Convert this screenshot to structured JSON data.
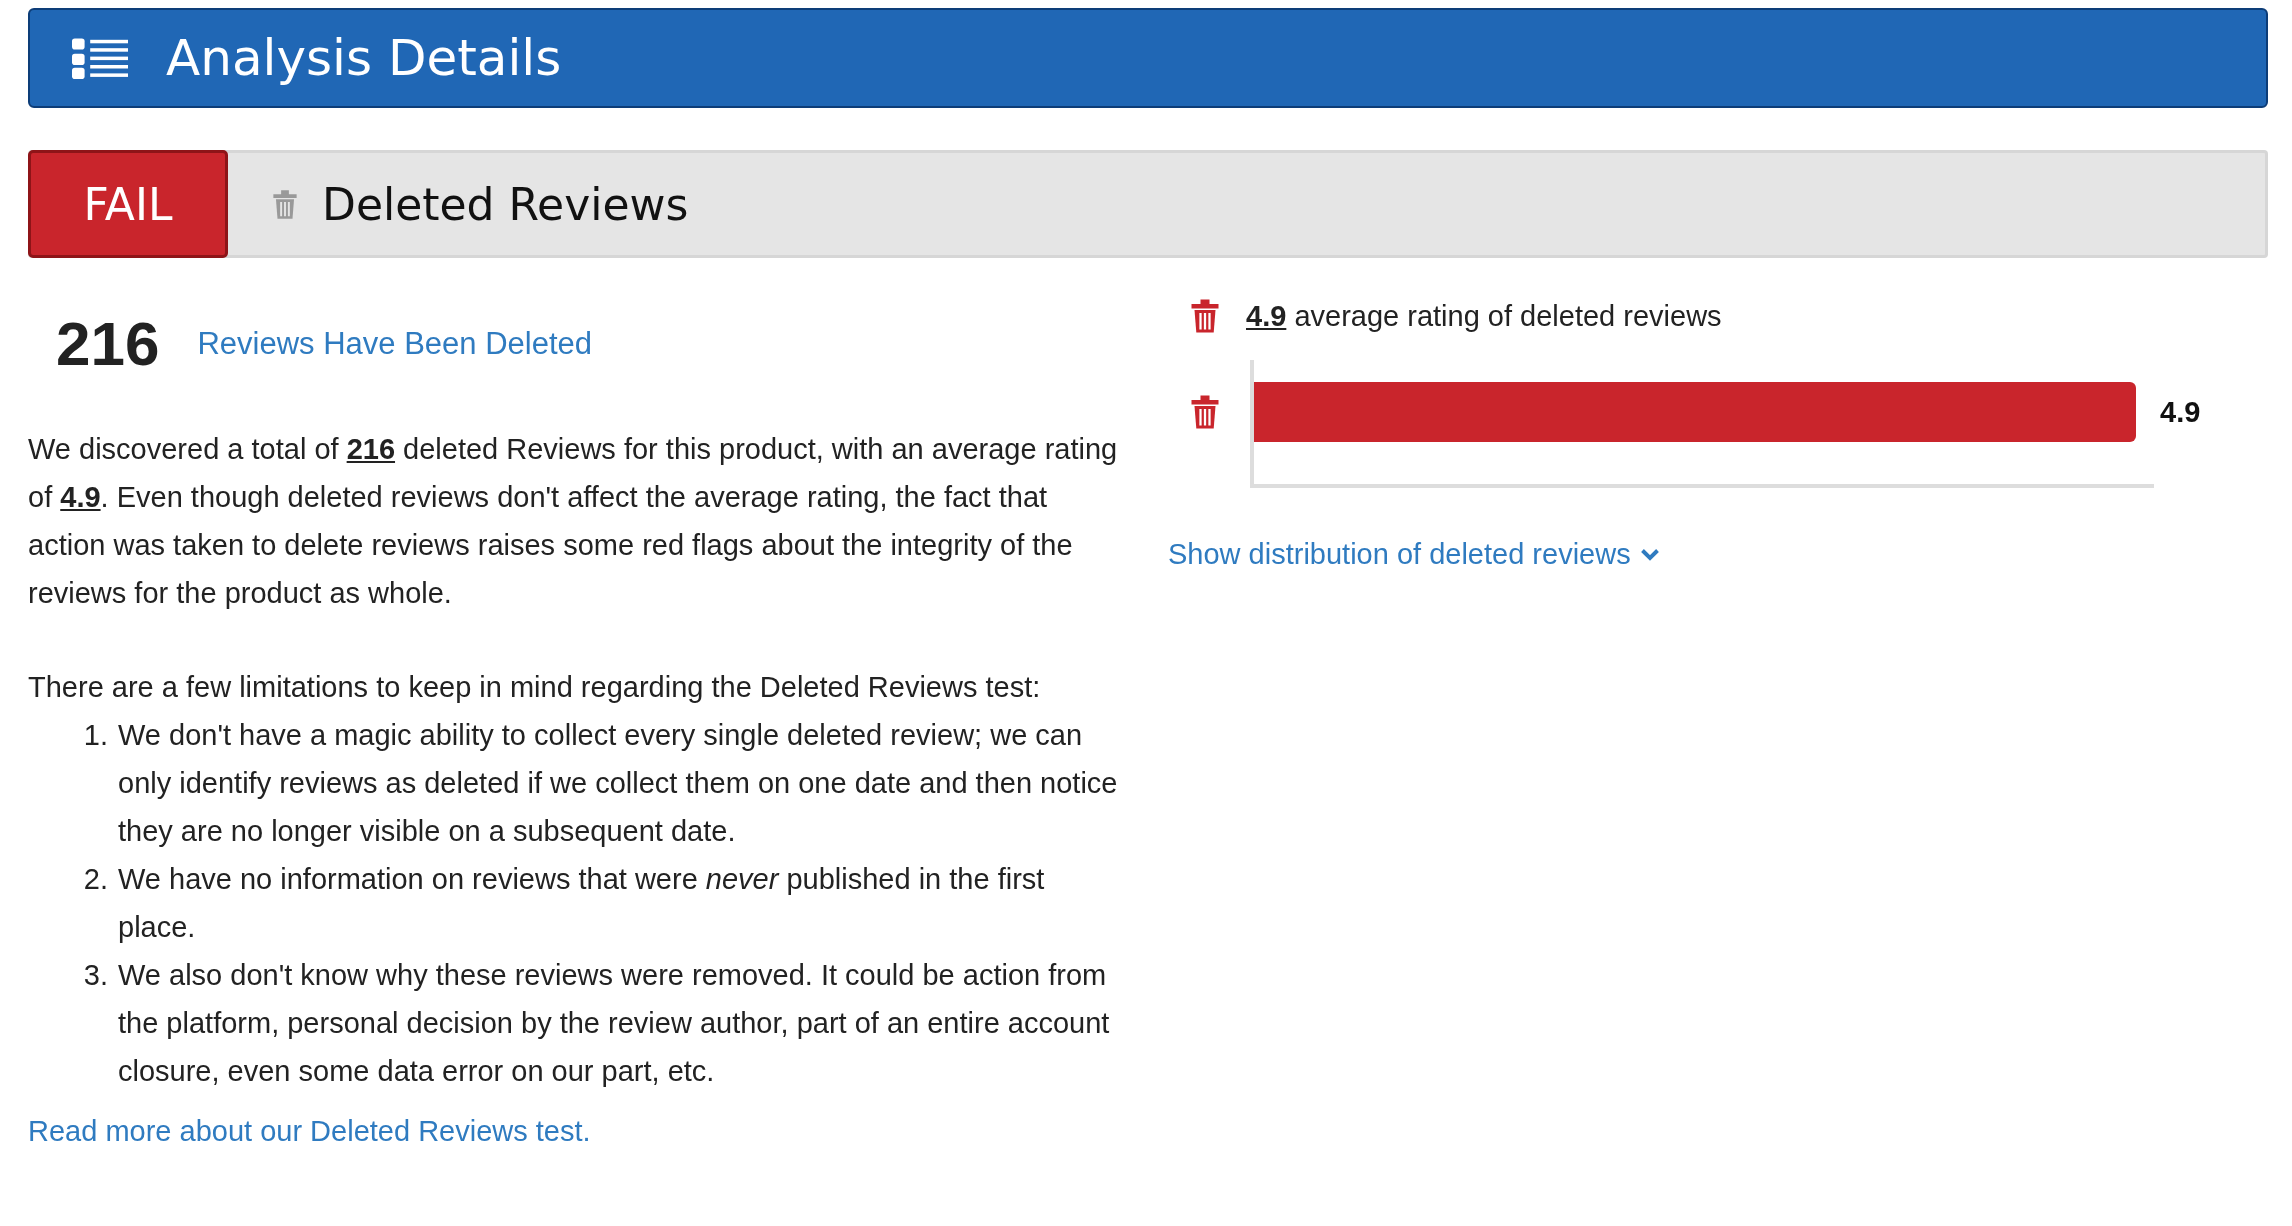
{
  "header": {
    "title": "Analysis Details"
  },
  "test": {
    "status": "FAIL",
    "name": "Deleted Reviews"
  },
  "summary": {
    "count": "216",
    "label": "Reviews Have Been Deleted"
  },
  "description": "We discovered a total of **216** deleted Reviews for this product, with an average rating of **4.9**. Even though deleted reviews don't affect the average rating, the fact that action was taken to delete reviews raises some red flags about the integrity of the reviews for the product as whole.",
  "limitations": {
    "intro": "There are a few limitations to keep in mind regarding the Deleted Reviews test:",
    "items": [
      {
        "number": "1.",
        "text": "We don't have a magic ability to collect every single deleted review; we can only identify reviews as deleted if we collect them on one date and then notice they are no longer visible on a subsequent date."
      },
      {
        "number": "2.",
        "text": "We have no information on reviews that were *never* published in the first place."
      },
      {
        "number": "3.",
        "text": "We also don't know why these reviews were removed. It could be action from the platform, personal decision by the review author, part of an entire account closure, even some data error on our part, etc."
      }
    ]
  },
  "read_more": "Read more about our Deleted Reviews test.",
  "rating": {
    "value": "4.9",
    "text": "average rating of deleted reviews",
    "bar": {
      "level": 0.98,
      "label": "4.9"
    }
  },
  "distribution_link": "Show distribution of deleted reviews"
}
